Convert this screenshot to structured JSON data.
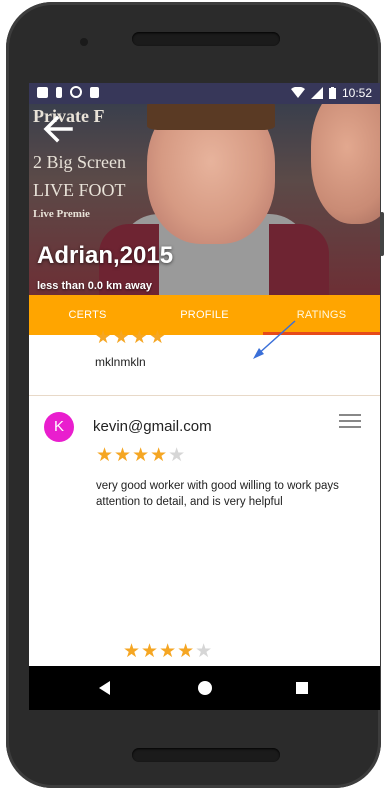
{
  "status_bar": {
    "time": "10:52"
  },
  "header": {
    "sign_lines": [
      "Private F",
      "2 Big Screen",
      "LIVE FOOT",
      "Live Premie"
    ],
    "name": "Adrian,2015",
    "distance": "less than 0.0 km away"
  },
  "tabs": [
    {
      "label": "CERTS",
      "active": false
    },
    {
      "label": "PROFILE",
      "active": false
    },
    {
      "label": "RATINGS",
      "active": true
    }
  ],
  "ratings": {
    "previous_card": {
      "comment": "mklnmkln"
    },
    "review": {
      "avatar_letter": "K",
      "email": "kevin@gmail.com",
      "stars_filled": 4,
      "stars_total": 5,
      "comment": "very good worker with good willing to work pays attention to detail, and is very helpful",
      "summary_stars_filled": 4,
      "summary_stars_total": 5
    }
  },
  "colors": {
    "tab_bar": "#ffa500",
    "star": "#f5a623",
    "avatar": "#e91ece",
    "annotation_arrow": "#3a6fd8"
  }
}
